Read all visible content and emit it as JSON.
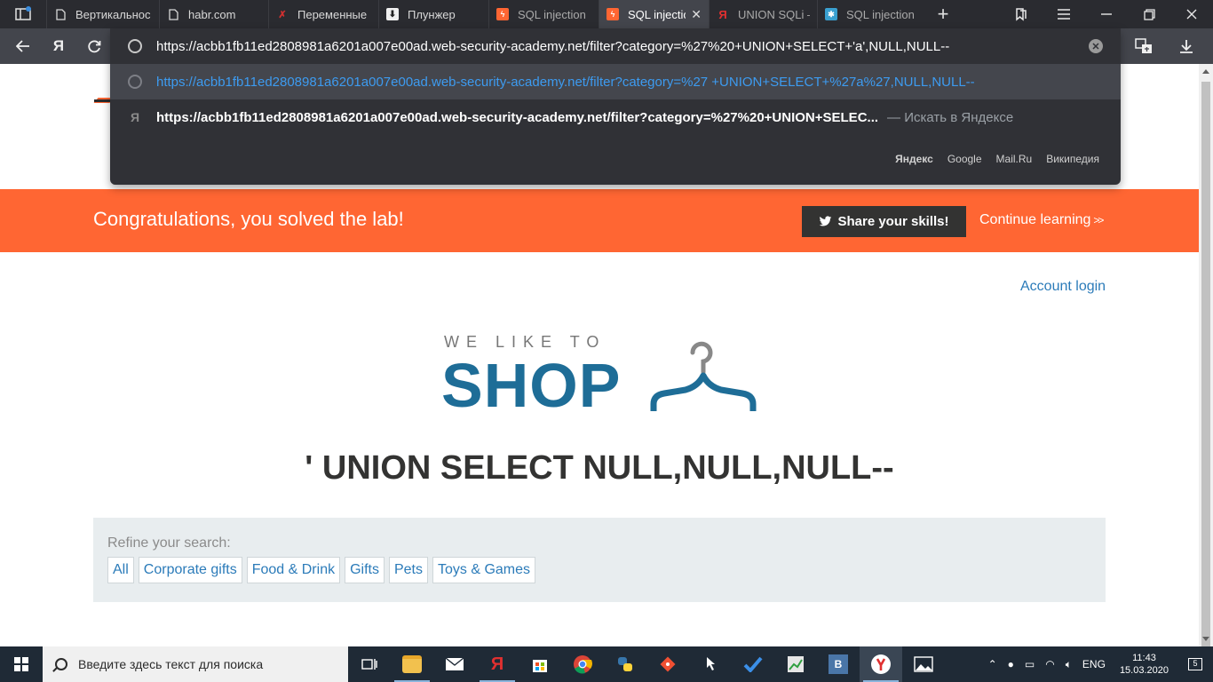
{
  "browser": {
    "tabs": [
      {
        "title": "Вертикальнос",
        "icon": "page-icon"
      },
      {
        "title": "habr.com",
        "icon": "page-icon"
      },
      {
        "title": "Переменные",
        "icon": "x-logo-icon"
      },
      {
        "title": "Плунжер",
        "icon": "download-icon"
      },
      {
        "title": "SQL injection",
        "icon": "burp-icon"
      },
      {
        "title": "SQL injectio",
        "icon": "burp-icon",
        "active": true
      },
      {
        "title": "UNION SQLi –",
        "icon": "yandex-icon"
      },
      {
        "title": "SQL injection",
        "icon": "portswigger-icon"
      }
    ],
    "address": "https://acbb1fb11ed2808981a6201a007e00ad.web-security-academy.net/filter?category=%27%20+UNION+SELECT+'a',NULL,NULL--",
    "suggestions": [
      {
        "text": "https://acbb1fb11ed2808981a6201a007e00ad.web-security-academy.net/filter?category=%27 +UNION+SELECT+%27a%27,NULL,NULL--"
      },
      {
        "text": "https://acbb1fb11ed2808981a6201a007e00ad.web-security-academy.net/filter?category=%27%20+UNION+SELEC...",
        "after": "— Искать в Яндексе"
      }
    ],
    "engines": [
      "Яндекс",
      "Google",
      "Mail.Ru",
      "Википедия"
    ],
    "nav_icons": [
      "back-arrow-icon",
      "yandex-icon",
      "refresh-icon"
    ]
  },
  "page": {
    "banner": {
      "message": "Congratulations, you solved the lab!",
      "share_label": "Share your skills!",
      "continue_label": "Continue learning"
    },
    "account_login": "Account login",
    "logo": {
      "small": "WE LIKE TO",
      "big": "SHOP"
    },
    "heading": "' UNION SELECT NULL,NULL,NULL--",
    "refine": {
      "label": "Refine your search:",
      "filters": [
        "All",
        "Corporate gifts",
        "Food & Drink",
        "Gifts",
        "Pets",
        "Toys & Games"
      ]
    }
  },
  "colors": {
    "banner": "#ff6633",
    "link": "#2b7bb9",
    "logo_blue": "#1e6d97",
    "browser_dark": "#303136",
    "highlight_url": "#3d9bf0"
  },
  "taskbar": {
    "search_placeholder": "Введите здесь текст для поиска",
    "language": "ENG",
    "time": "11:43",
    "date": "15.03.2020",
    "notifications": "5"
  }
}
